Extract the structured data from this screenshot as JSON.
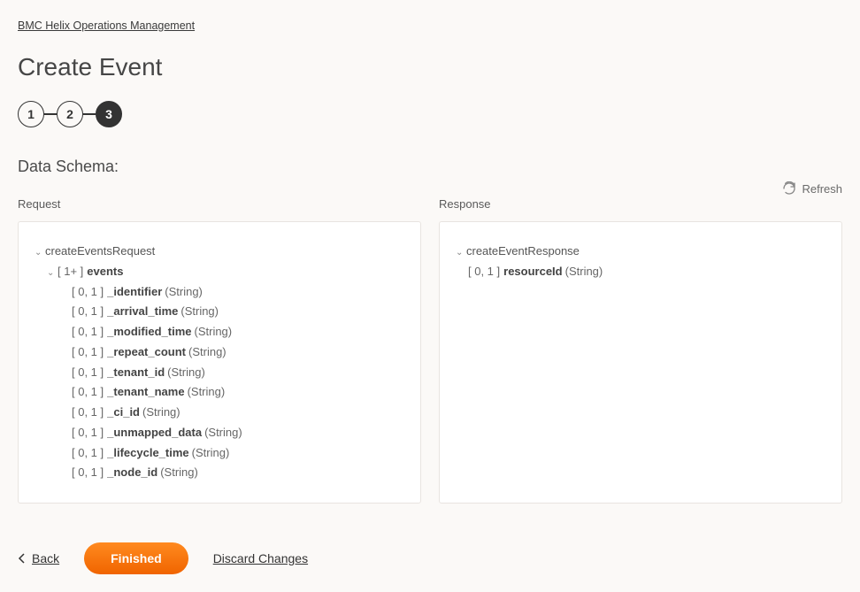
{
  "breadcrumb": "BMC Helix Operations Management",
  "page_title": "Create Event",
  "stepper": {
    "steps": [
      "1",
      "2",
      "3"
    ],
    "active_index": 2
  },
  "section_title": "Data Schema:",
  "refresh_label": "Refresh",
  "panels": {
    "request": {
      "label": "Request",
      "root": {
        "name": "createEventsRequest",
        "children": [
          {
            "mult": "[ 1+ ]",
            "name": "events",
            "children": [
              {
                "mult": "[ 0, 1 ]",
                "name": "_identifier",
                "type": "(String)"
              },
              {
                "mult": "[ 0, 1 ]",
                "name": "_arrival_time",
                "type": "(String)"
              },
              {
                "mult": "[ 0, 1 ]",
                "name": "_modified_time",
                "type": "(String)"
              },
              {
                "mult": "[ 0, 1 ]",
                "name": "_repeat_count",
                "type": "(String)"
              },
              {
                "mult": "[ 0, 1 ]",
                "name": "_tenant_id",
                "type": "(String)"
              },
              {
                "mult": "[ 0, 1 ]",
                "name": "_tenant_name",
                "type": "(String)"
              },
              {
                "mult": "[ 0, 1 ]",
                "name": "_ci_id",
                "type": "(String)"
              },
              {
                "mult": "[ 0, 1 ]",
                "name": "_unmapped_data",
                "type": "(String)"
              },
              {
                "mult": "[ 0, 1 ]",
                "name": "_lifecycle_time",
                "type": "(String)"
              },
              {
                "mult": "[ 0, 1 ]",
                "name": "_node_id",
                "type": "(String)"
              }
            ]
          }
        ]
      }
    },
    "response": {
      "label": "Response",
      "root": {
        "name": "createEventResponse",
        "children": [
          {
            "mult": "[ 0, 1 ]",
            "name": "resourceId",
            "type": "(String)"
          }
        ]
      }
    }
  },
  "footer": {
    "back": "Back",
    "finished": "Finished",
    "discard": "Discard Changes"
  }
}
